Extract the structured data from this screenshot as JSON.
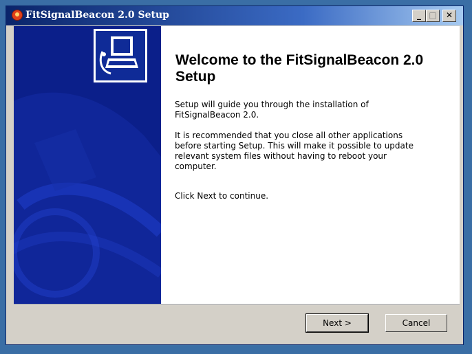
{
  "window": {
    "title": "FitSignalBeacon 2.0 Setup",
    "app_icon": "installer-icon",
    "controls": {
      "minimize_label": "_",
      "maximize_label": "□",
      "close_label": "✕"
    }
  },
  "sidebar": {
    "logo_icon": "computer-install-icon",
    "colors": {
      "background": "#0b1f8a",
      "accent": "#1e3cc8"
    }
  },
  "content": {
    "heading": "Welcome to the FitSignalBeacon 2.0 Setup",
    "paragraph1": "Setup will guide you through the installation of FitSignalBeacon 2.0.",
    "paragraph2": "It is recommended that you close all other applications before starting Setup. This will make it possible to update relevant system files without having to reboot your computer.",
    "paragraph3": "Click Next to continue."
  },
  "buttons": {
    "next_label": "Next >",
    "cancel_label": "Cancel"
  }
}
